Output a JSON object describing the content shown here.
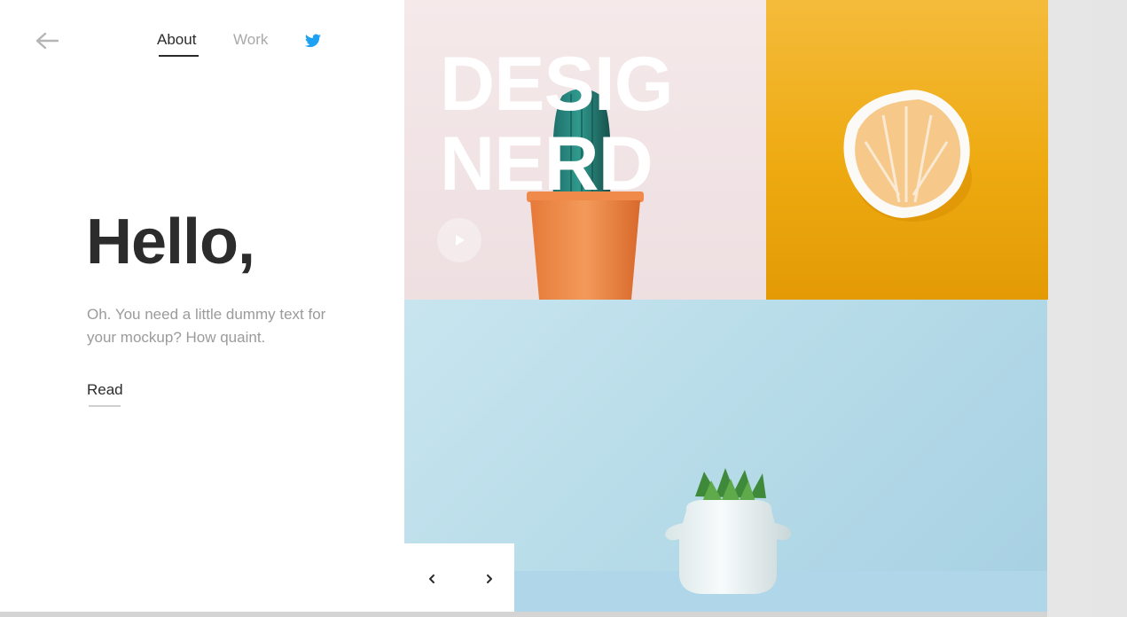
{
  "nav": {
    "items": [
      {
        "label": "About",
        "active": true
      },
      {
        "label": "Work",
        "active": false
      }
    ],
    "back_icon": "arrow-left-icon",
    "social_icon": "twitter-icon"
  },
  "hero": {
    "heading": "Hello,",
    "text": "Oh. You need a little dummy text for your mockup? How quaint.",
    "read_label": "Read"
  },
  "feature": {
    "headline_line1": "DESIG",
    "headline_line2": "NERD",
    "play_icon": "play-icon"
  },
  "pager": {
    "prev_icon": "chevron-left-icon",
    "next_icon": "chevron-right-icon"
  },
  "colors": {
    "text_dark": "#2b2b2b",
    "text_muted": "#9b9b9b",
    "twitter_blue": "#1da1f2",
    "pink_tile": "#f1e3e5",
    "orange_tile": "#eeaa11",
    "blue_tile": "#b6dbe8"
  }
}
